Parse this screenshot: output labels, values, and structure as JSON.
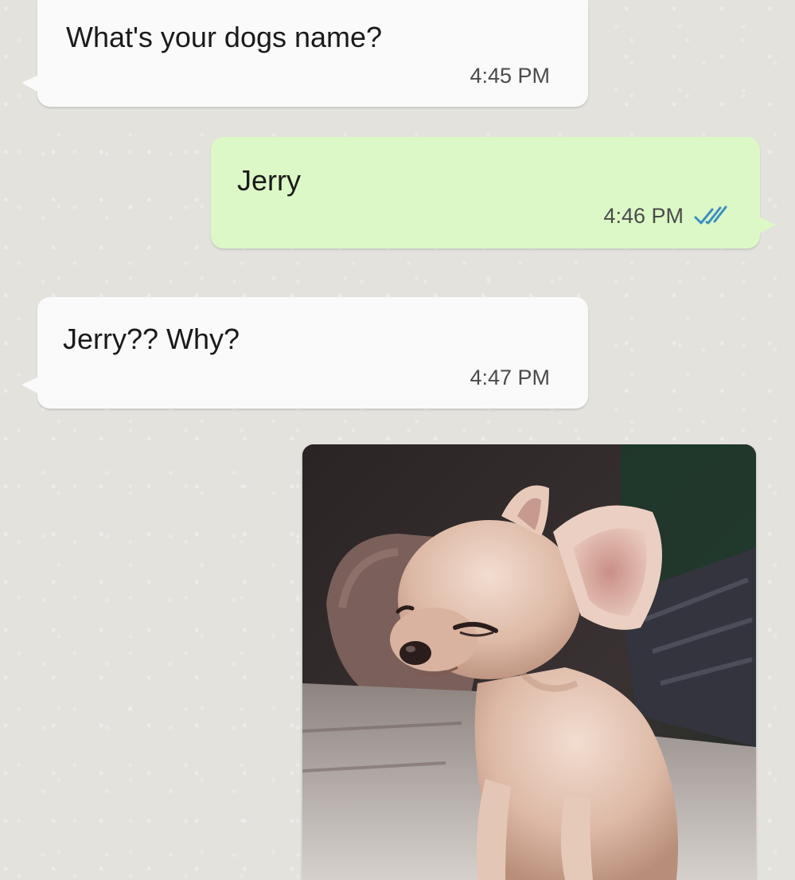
{
  "messages": [
    {
      "direction": "incoming",
      "text": "What's your dogs name?",
      "time": "4:45 PM"
    },
    {
      "direction": "outgoing",
      "text": "Jerry",
      "time": "4:46 PM",
      "status": "read"
    },
    {
      "direction": "incoming",
      "text": "Jerry?? Why?",
      "time": "4:47 PM"
    },
    {
      "direction": "outgoing",
      "type": "image",
      "image_subject": "chihuahua-puppy-photo"
    }
  ],
  "colors": {
    "incoming_bubble": "#fafafa",
    "outgoing_bubble": "#dcf8c6",
    "read_ticks": "#34b7f1",
    "chat_background": "#e3e2dd"
  },
  "icons": {
    "read_receipt": "double-check-icon"
  }
}
